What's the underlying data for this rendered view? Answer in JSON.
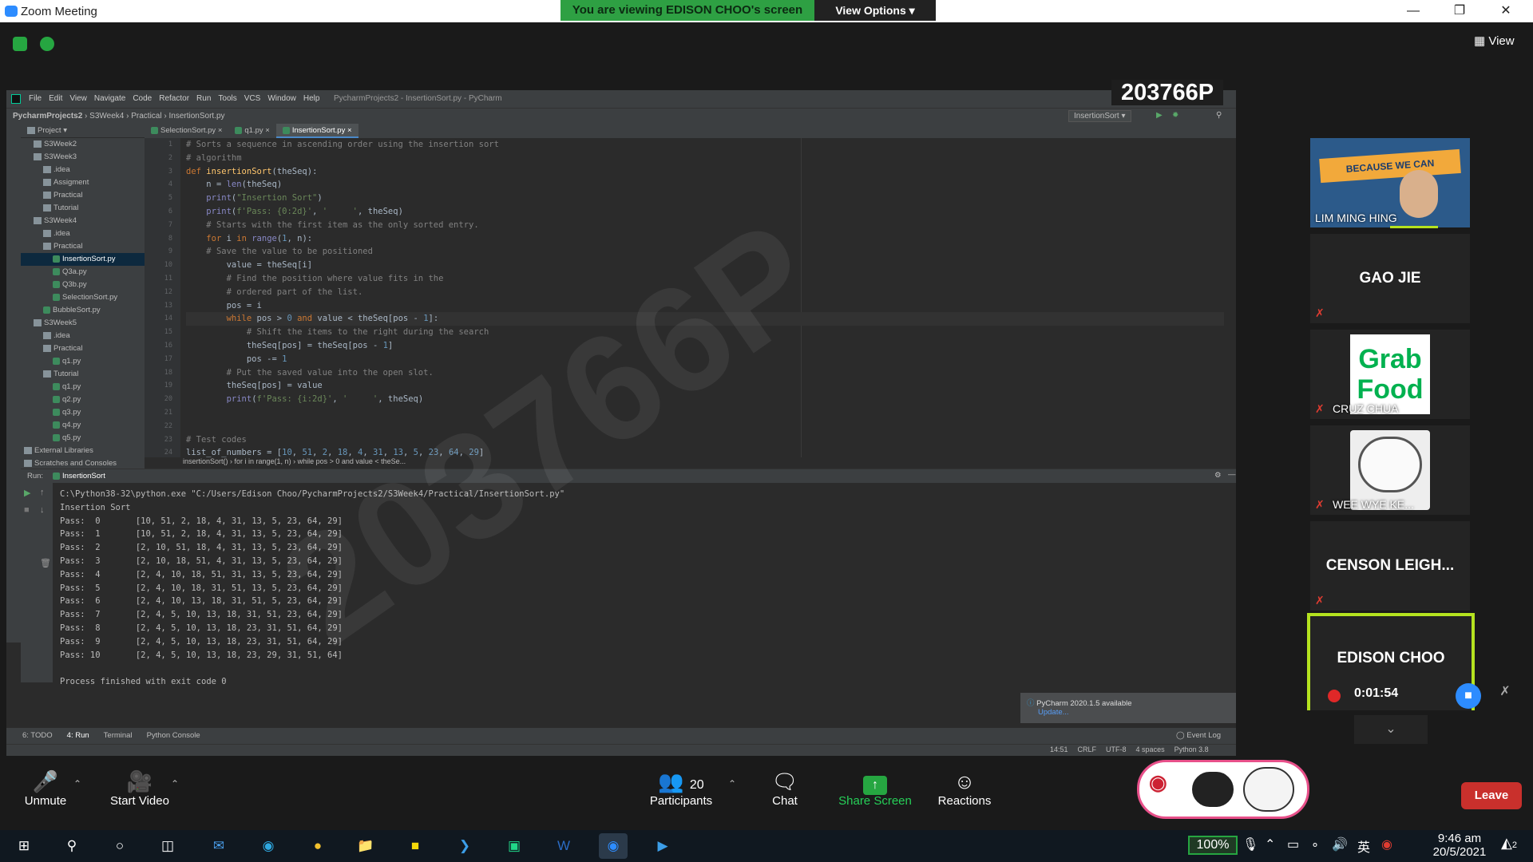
{
  "window": {
    "title": "Zoom Meeting"
  },
  "banner": {
    "viewing": "You are viewing EDISON CHOO's screen",
    "view_options": "View Options"
  },
  "view_label": "View",
  "stamp": "203766P",
  "ide": {
    "menus": [
      "File",
      "Edit",
      "View",
      "Navigate",
      "Code",
      "Refactor",
      "Run",
      "Tools",
      "VCS",
      "Window",
      "Help"
    ],
    "window_title": "PycharmProjects2 - InsertionSort.py - PyCharm",
    "nav": [
      "PycharmProjects2",
      "S3Week4",
      "Practical",
      "InsertionSort.py"
    ],
    "run_config": "InsertionSort",
    "project_label": "Project",
    "tree": [
      {
        "label": "S3Week2",
        "indent": 1,
        "type": "folder"
      },
      {
        "label": "S3Week3",
        "indent": 1,
        "type": "folder"
      },
      {
        "label": ".idea",
        "indent": 2,
        "type": "folder"
      },
      {
        "label": "Assigment",
        "indent": 2,
        "type": "folder"
      },
      {
        "label": "Practical",
        "indent": 2,
        "type": "folder"
      },
      {
        "label": "Tutorial",
        "indent": 2,
        "type": "folder"
      },
      {
        "label": "S3Week4",
        "indent": 1,
        "type": "folder"
      },
      {
        "label": ".idea",
        "indent": 2,
        "type": "folder"
      },
      {
        "label": "Practical",
        "indent": 2,
        "type": "folder"
      },
      {
        "label": "InsertionSort.py",
        "indent": 3,
        "type": "py",
        "selected": true
      },
      {
        "label": "Q3a.py",
        "indent": 3,
        "type": "py"
      },
      {
        "label": "Q3b.py",
        "indent": 3,
        "type": "py"
      },
      {
        "label": "SelectionSort.py",
        "indent": 3,
        "type": "py"
      },
      {
        "label": "BubbleSort.py",
        "indent": 2,
        "type": "py"
      },
      {
        "label": "S3Week5",
        "indent": 1,
        "type": "folder"
      },
      {
        "label": ".idea",
        "indent": 2,
        "type": "folder"
      },
      {
        "label": "Practical",
        "indent": 2,
        "type": "folder"
      },
      {
        "label": "q1.py",
        "indent": 3,
        "type": "py"
      },
      {
        "label": "Tutorial",
        "indent": 2,
        "type": "folder"
      },
      {
        "label": "q1.py",
        "indent": 3,
        "type": "py"
      },
      {
        "label": "q2.py",
        "indent": 3,
        "type": "py"
      },
      {
        "label": "q3.py",
        "indent": 3,
        "type": "py"
      },
      {
        "label": "q4.py",
        "indent": 3,
        "type": "py"
      },
      {
        "label": "q5.py",
        "indent": 3,
        "type": "py"
      },
      {
        "label": "External Libraries",
        "indent": 0,
        "type": "folder"
      },
      {
        "label": "Scratches and Consoles",
        "indent": 0,
        "type": "folder"
      }
    ],
    "tabs": [
      "SelectionSort.py",
      "q1.py",
      "InsertionSort.py"
    ],
    "active_tab": 2,
    "line_numbers": [
      "1",
      "2",
      "3",
      "4",
      "5",
      "6",
      "7",
      "8",
      "9",
      "10",
      "11",
      "12",
      "13",
      "14",
      "15",
      "16",
      "17",
      "18",
      "19",
      "20",
      "21",
      "22",
      "23",
      "24"
    ],
    "code": [
      "# Sorts a sequence in ascending order using the insertion sort",
      "# algorithm",
      "def insertionSort(theSeq):",
      "    n = len(theSeq)",
      "    print(\"Insertion Sort\")",
      "    print(f'Pass: {0:2d}', '     ', theSeq)",
      "    # Starts with the first item as the only sorted entry.",
      "    for i in range(1, n):",
      "    # Save the value to be positioned",
      "        value = theSeq[i]",
      "        # Find the position where value fits in the",
      "        # ordered part of the list.",
      "        pos = i",
      "        while pos > 0 and value < theSeq[pos - 1]:",
      "            # Shift the items to the right during the search",
      "            theSeq[pos] = theSeq[pos - 1]",
      "            pos -= 1",
      "        # Put the saved value into the open slot.",
      "        theSeq[pos] = value",
      "        print(f'Pass: {i:2d}', '     ', theSeq)",
      "",
      "",
      "# Test codes",
      "list_of_numbers = [10, 51, 2, 18, 4, 31, 13, 5, 23, 64, 29]"
    ],
    "breadcrumb": [
      "insertionSort()",
      "for i in range(1, n)",
      "while pos > 0 and value < theSe..."
    ],
    "run_label": "Run:",
    "run_tab": "InsertionSort",
    "console": [
      "C:\\Python38-32\\python.exe \"C:/Users/Edison Choo/PycharmProjects2/S3Week4/Practical/InsertionSort.py\"",
      "Insertion Sort",
      "Pass:  0       [10, 51, 2, 18, 4, 31, 13, 5, 23, 64, 29]",
      "Pass:  1       [10, 51, 2, 18, 4, 31, 13, 5, 23, 64, 29]",
      "Pass:  2       [2, 10, 51, 18, 4, 31, 13, 5, 23, 64, 29]",
      "Pass:  3       [2, 10, 18, 51, 4, 31, 13, 5, 23, 64, 29]",
      "Pass:  4       [2, 4, 10, 18, 51, 31, 13, 5, 23, 64, 29]",
      "Pass:  5       [2, 4, 10, 18, 31, 51, 13, 5, 23, 64, 29]",
      "Pass:  6       [2, 4, 10, 13, 18, 31, 51, 5, 23, 64, 29]",
      "Pass:  7       [2, 4, 5, 10, 13, 18, 31, 51, 23, 64, 29]",
      "Pass:  8       [2, 4, 5, 10, 13, 18, 23, 31, 51, 64, 29]",
      "Pass:  9       [2, 4, 5, 10, 13, 18, 23, 31, 51, 64, 29]",
      "Pass: 10       [2, 4, 5, 10, 13, 18, 23, 29, 31, 51, 64]",
      "",
      "Process finished with exit code 0"
    ],
    "notification": {
      "title": "PyCharm 2020.1.5 available",
      "link": "Update..."
    },
    "bottom_tools": [
      "6: TODO",
      "4: Run",
      "Terminal",
      "Python Console"
    ],
    "event_log": "Event Log",
    "status": [
      "14:51",
      "CRLF",
      "UTF-8",
      "4 spaces",
      "Python 3.8"
    ]
  },
  "participants": [
    {
      "name": "LIM MING HING",
      "video": true,
      "video_text": "BECAUSE WE CAN"
    },
    {
      "name": "GAO JIE",
      "muted": true
    },
    {
      "name": "CRUZ CHUA",
      "muted": true,
      "logo": "Grab Food"
    },
    {
      "name": "WEE WYE KE...",
      "muted": true
    },
    {
      "name": "CENSON  LEIGH...",
      "muted": true
    },
    {
      "name": "EDISON CHOO",
      "timer": "0:01:54",
      "active": true
    }
  ],
  "controls": {
    "unmute": "Unmute",
    "start_video": "Start Video",
    "participants": "Participants",
    "participants_count": "20",
    "chat": "Chat",
    "share_screen": "Share Screen",
    "reactions": "Reactions",
    "leave": "Leave"
  },
  "taskbar": {
    "battery": "100%",
    "ime": "英",
    "time": "9:46 am",
    "date": "20/5/2021",
    "notifications": "2"
  },
  "colors": {
    "zoom_green": "#2ea043",
    "leave_red": "#c9302c",
    "active_border": "#b5e31f",
    "zoom_blue": "#2d8cff"
  }
}
